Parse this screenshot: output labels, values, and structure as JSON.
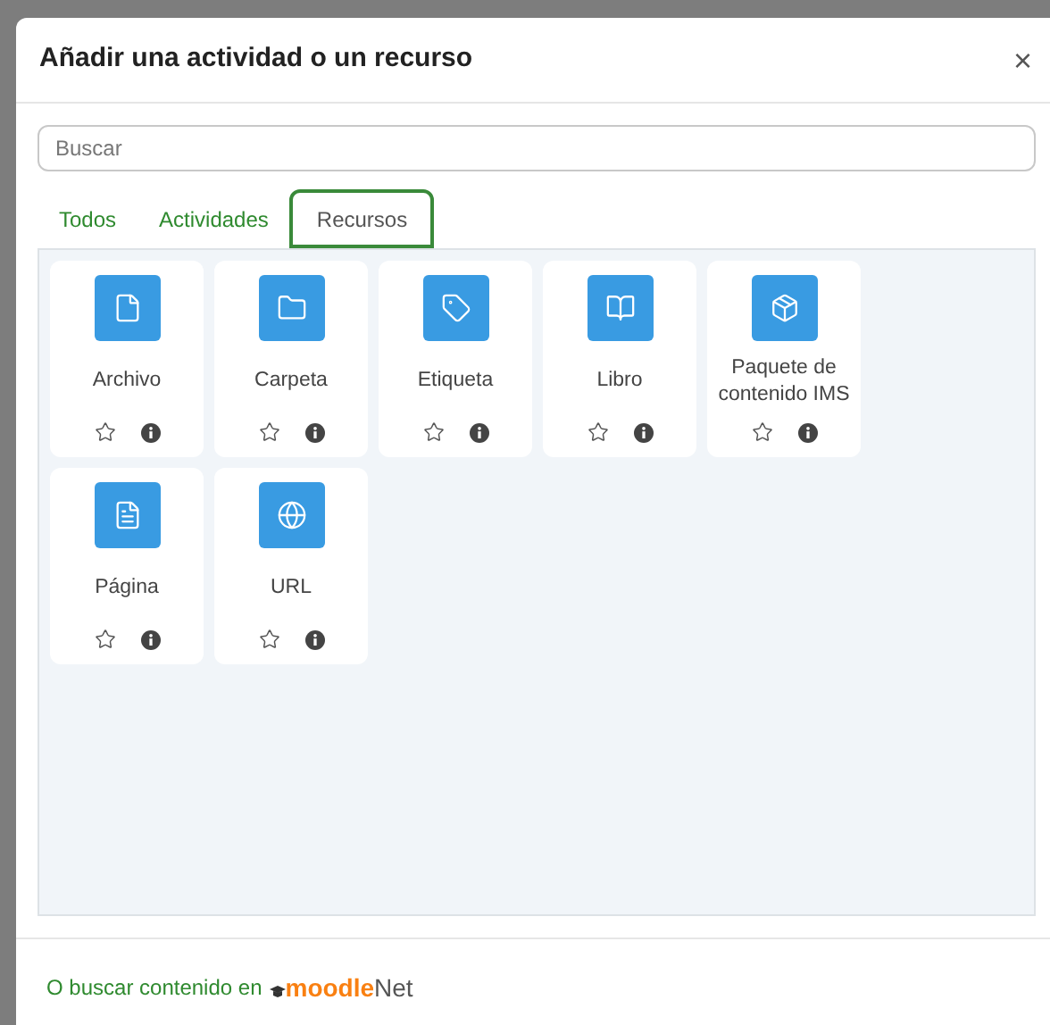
{
  "dialog": {
    "title": "Añadir una actividad o un recurso",
    "close": "×"
  },
  "search": {
    "placeholder": "Buscar"
  },
  "tabs": [
    {
      "label": "Todos",
      "selected": false
    },
    {
      "label": "Actividades",
      "selected": false
    },
    {
      "label": "Recursos",
      "selected": true
    }
  ],
  "items": [
    {
      "label": "Archivo",
      "starred": false
    },
    {
      "label": "Carpeta",
      "starred": false
    },
    {
      "label": "Etiqueta",
      "starred": false
    },
    {
      "label": "Libro",
      "starred": false
    },
    {
      "label": "Paquete de contenido IMS",
      "starred": false
    },
    {
      "label": "Página",
      "starred": false
    },
    {
      "label": "URL",
      "starred": false
    }
  ],
  "footer": {
    "text": "O buscar contenido en",
    "logo_main": "moodle",
    "logo_suffix": "Net"
  }
}
